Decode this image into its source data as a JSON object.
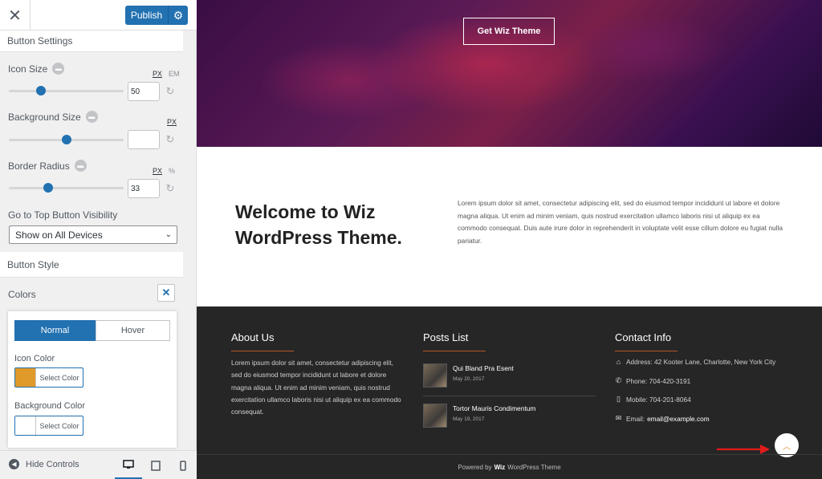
{
  "topbar": {
    "close_glyph": "✕",
    "publish_label": "Publish",
    "gear_glyph": "⚙"
  },
  "sections": {
    "button_settings": "Button Settings",
    "button_style": "Button Style"
  },
  "controls": {
    "icon_size": {
      "label": "Icon Size",
      "units": [
        "PX",
        "EM"
      ],
      "value": "50",
      "slider_fraction": 0.26
    },
    "background_size": {
      "label": "Background Size",
      "units": [
        "PX"
      ],
      "value": "",
      "slider_fraction": 0.5
    },
    "border_radius": {
      "label": "Border Radius",
      "units": [
        "PX",
        "%"
      ],
      "value": "33",
      "slider_fraction": 0.33
    },
    "visibility": {
      "label": "Go to Top Button Visibility",
      "selected": "Show on All Devices"
    },
    "colors": {
      "label": "Colors",
      "close_glyph": "✕"
    }
  },
  "colors_popup": {
    "tabs": {
      "normal": "Normal",
      "hover": "Hover"
    },
    "icon_color": {
      "label": "Icon Color",
      "button": "Select Color",
      "swatch": "#e09a2a"
    },
    "background_color": {
      "label": "Background Color",
      "button": "Select Color",
      "swatch": "#ffffff"
    }
  },
  "footer_controls": {
    "hide_label": "Hide Controls",
    "icons": [
      "desktop-icon",
      "tablet-icon",
      "mobile-icon"
    ]
  },
  "preview": {
    "hero_button": "Get Wiz Theme",
    "welcome_title": "Welcome to Wiz WordPress Theme.",
    "welcome_text": "Lorem ipsum dolor sit amet, consectetur adipiscing elit, sed do eiusmod tempor incididunt ut labore et dolore magna aliqua. Ut enim ad minim veniam, quis nostrud exercitation ullamco laboris nisi ut aliquip ex ea commodo consequat. Duis aute irure dolor in reprehenderit in voluptate velit esse cillum dolore eu fugiat nulla pariatur.",
    "about": {
      "title": "About Us",
      "text": "Lorem ipsum dolor sit amet, consectetur adipiscing elit, sed do eiusmod tempor incididunt ut labore et dolore magna aliqua. Ut enim ad minim veniam, quis nostrud exercitation ullamco laboris nisi ut aliquip ex ea commodo consequat."
    },
    "posts": {
      "title": "Posts List",
      "items": [
        {
          "title": "Qui Bland Pra Esent",
          "date": "May 20, 2017"
        },
        {
          "title": "Tortor Mauris Condimentum",
          "date": "May 19, 2017"
        }
      ]
    },
    "contact": {
      "title": "Contact Info",
      "address": "Address: 42 Kooter Lane, Charlotte, New York City",
      "phone": "Phone: 704-420-3191",
      "mobile": "Mobile: 704-201-8064",
      "email_label": "Email:",
      "email": "email@example.com"
    },
    "credits": {
      "prefix": "Powered by",
      "brand": "Wiz",
      "suffix": "WordPress Theme"
    },
    "scroll_top_glyph": "︿",
    "accent": "#e08a2c",
    "arrow_color": "#e11b1b"
  }
}
